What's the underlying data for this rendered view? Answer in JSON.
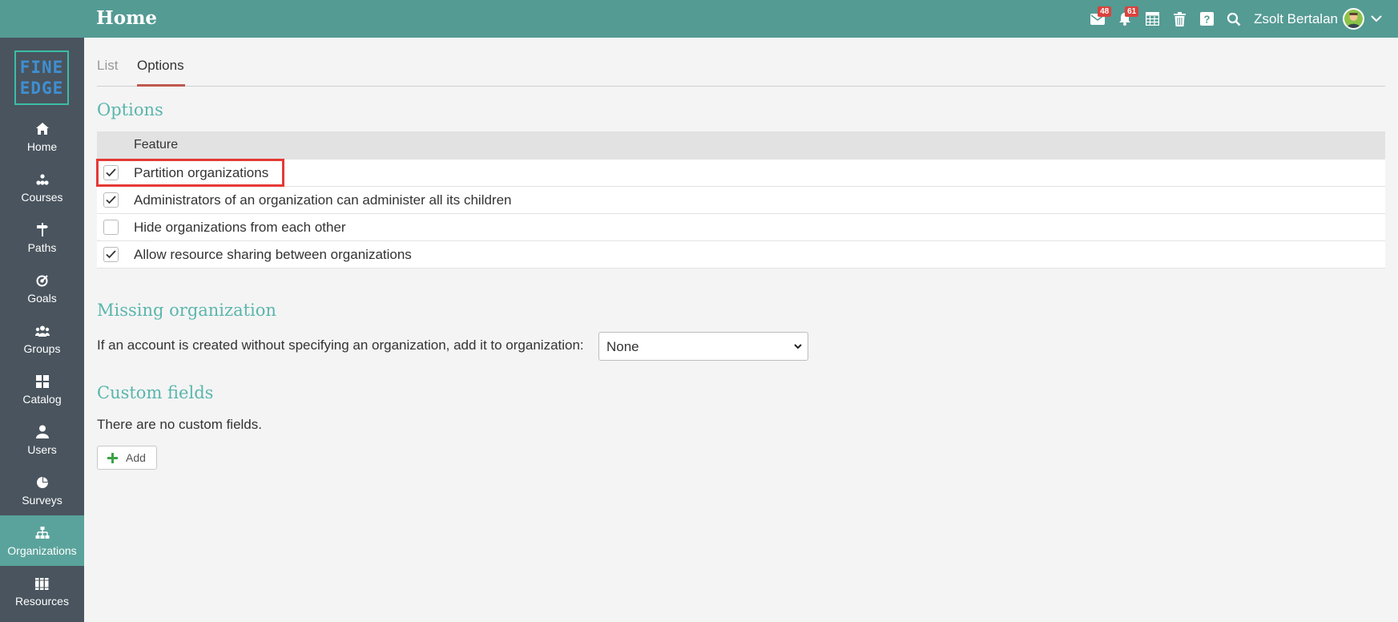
{
  "header": {
    "title": "Home",
    "messages_badge": "48",
    "notifications_badge": "61",
    "username": "Zsolt Bertalan",
    "icons": [
      "envelope-icon",
      "bell-icon",
      "calendar-icon",
      "trash-icon",
      "help-icon",
      "search-icon",
      "avatar",
      "chevron-down-icon"
    ]
  },
  "logo": {
    "line1": "FINE",
    "line2": "EDGE"
  },
  "sidebar": {
    "items": [
      {
        "label": "Home",
        "icon": "home-icon"
      },
      {
        "label": "Courses",
        "icon": "courses-icon"
      },
      {
        "label": "Paths",
        "icon": "signpost-icon"
      },
      {
        "label": "Goals",
        "icon": "target-icon"
      },
      {
        "label": "Groups",
        "icon": "group-icon"
      },
      {
        "label": "Catalog",
        "icon": "grid-icon"
      },
      {
        "label": "Users",
        "icon": "user-icon"
      },
      {
        "label": "Surveys",
        "icon": "pie-icon"
      },
      {
        "label": "Organizations",
        "icon": "org-chart-icon",
        "active": true
      },
      {
        "label": "Resources",
        "icon": "books-icon"
      }
    ]
  },
  "tabs": [
    {
      "label": "List",
      "active": false
    },
    {
      "label": "Options",
      "active": true
    }
  ],
  "options": {
    "title": "Options",
    "column_header": "Feature",
    "rows": [
      {
        "label": "Partition organizations",
        "checked": true
      },
      {
        "label": "Administrators of an organization can administer all its children",
        "checked": true
      },
      {
        "label": "Hide organizations from each other",
        "checked": false
      },
      {
        "label": "Allow resource sharing between organizations",
        "checked": true
      }
    ]
  },
  "missing": {
    "title": "Missing organization",
    "text": "If an account is created without specifying an organization, add it to organization:",
    "select_value": "None"
  },
  "custom_fields": {
    "title": "Custom fields",
    "empty_text": "There are no custom fields.",
    "add_label": "Add"
  },
  "colors": {
    "topbar": "#549b94",
    "sidebar": "#49545e",
    "sidebar_active": "#5aa39c",
    "section_title": "#5ab6ad",
    "tab_underline": "#c0584f",
    "badge": "#d9433d",
    "highlight": "#e53935",
    "add_icon": "#3aa346"
  }
}
